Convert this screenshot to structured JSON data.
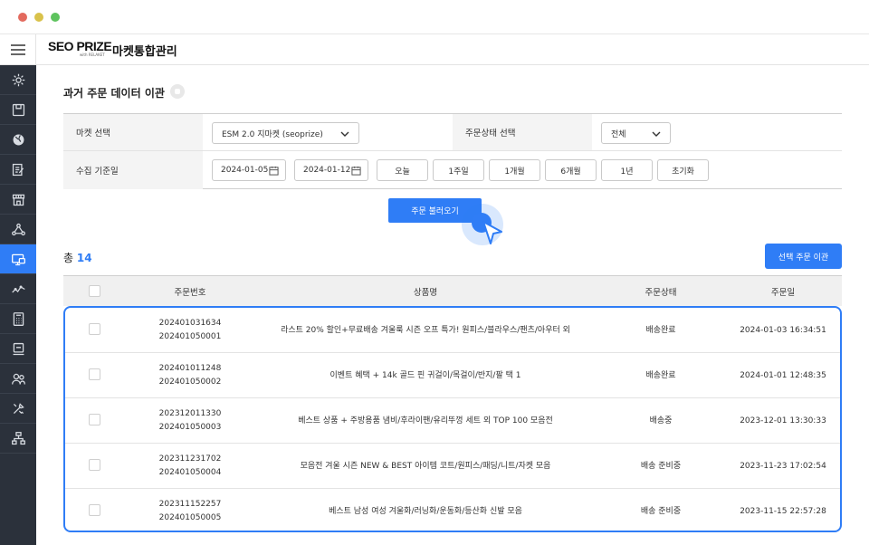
{
  "app": {
    "logo": "SEO PRIZE",
    "logo_sub": "with RELAKET",
    "title": "마켓통합관리"
  },
  "sidebar": {
    "items": [
      {
        "icon": "gear-icon"
      },
      {
        "icon": "box-icon"
      },
      {
        "icon": "globe-icon"
      },
      {
        "icon": "edit-document-icon"
      },
      {
        "icon": "store-icon"
      },
      {
        "icon": "network-icon"
      },
      {
        "icon": "monitor-transfer-icon",
        "active": true
      },
      {
        "icon": "trend-line-icon"
      },
      {
        "icon": "calculator-icon"
      },
      {
        "icon": "laptop-icon"
      },
      {
        "icon": "users-icon"
      },
      {
        "icon": "tools-icon"
      },
      {
        "icon": "hierarchy-icon"
      }
    ]
  },
  "page": {
    "title": "과거 주문 데이터 이관"
  },
  "filter": {
    "market_label": "마켓 선택",
    "market_value": "ESM 2.0 지마켓 (seoprize)",
    "status_label": "주문상태 선택",
    "status_value": "전체",
    "date_label": "수집 기준일",
    "date_from": "2024-01-05",
    "date_to": "2024-01-12",
    "quick": [
      "오늘",
      "1주일",
      "1개월",
      "6개월",
      "1년",
      "초기화"
    ]
  },
  "actions": {
    "load": "주문 불러오기",
    "transfer": "선택 주문 이관"
  },
  "summary": {
    "total_label": "총",
    "total_count": "14"
  },
  "table": {
    "headers": [
      "주문번호",
      "상품명",
      "주문상태",
      "주문일"
    ],
    "rows": [
      {
        "order1": "202401031634",
        "order2": "202401050001",
        "product": "라스트 20% 할인+무료배송 겨울룩 시즌 오프 특가! 원피스/블라우스/팬츠/아우터 외",
        "status": "배송완료",
        "date": "2024-01-03 16:34:51"
      },
      {
        "order1": "202401011248",
        "order2": "202401050002",
        "product": "이벤트 혜택 + 14k 골드 핀 귀걸이/목걸이/반지/팔 택 1",
        "status": "배송완료",
        "date": "2024-01-01 12:48:35"
      },
      {
        "order1": "202312011330",
        "order2": "202401050003",
        "product": "베스트 상품 + 주방용품 냄비/후라이팬/유리뚜껑 세트 외 TOP 100 모음전",
        "status": "배송중",
        "date": "2023-12-01 13:30:33"
      },
      {
        "order1": "202311231702",
        "order2": "202401050004",
        "product": "모음전 겨울 시즌 NEW & BEST 아이템 코트/원피스/패딩/니트/자켓 모음",
        "status": "배송 준비중",
        "date": "2023-11-23 17:02:54"
      },
      {
        "order1": "202311152257",
        "order2": "202401050005",
        "product": "베스트 남성 여성 겨울화/러닝화/운동화/등산화 신발 모음",
        "status": "배송 준비중",
        "date": "2023-11-15 22:57:28"
      }
    ]
  },
  "colors": {
    "accent": "#2f7df6",
    "sidebar": "#2b313b"
  }
}
